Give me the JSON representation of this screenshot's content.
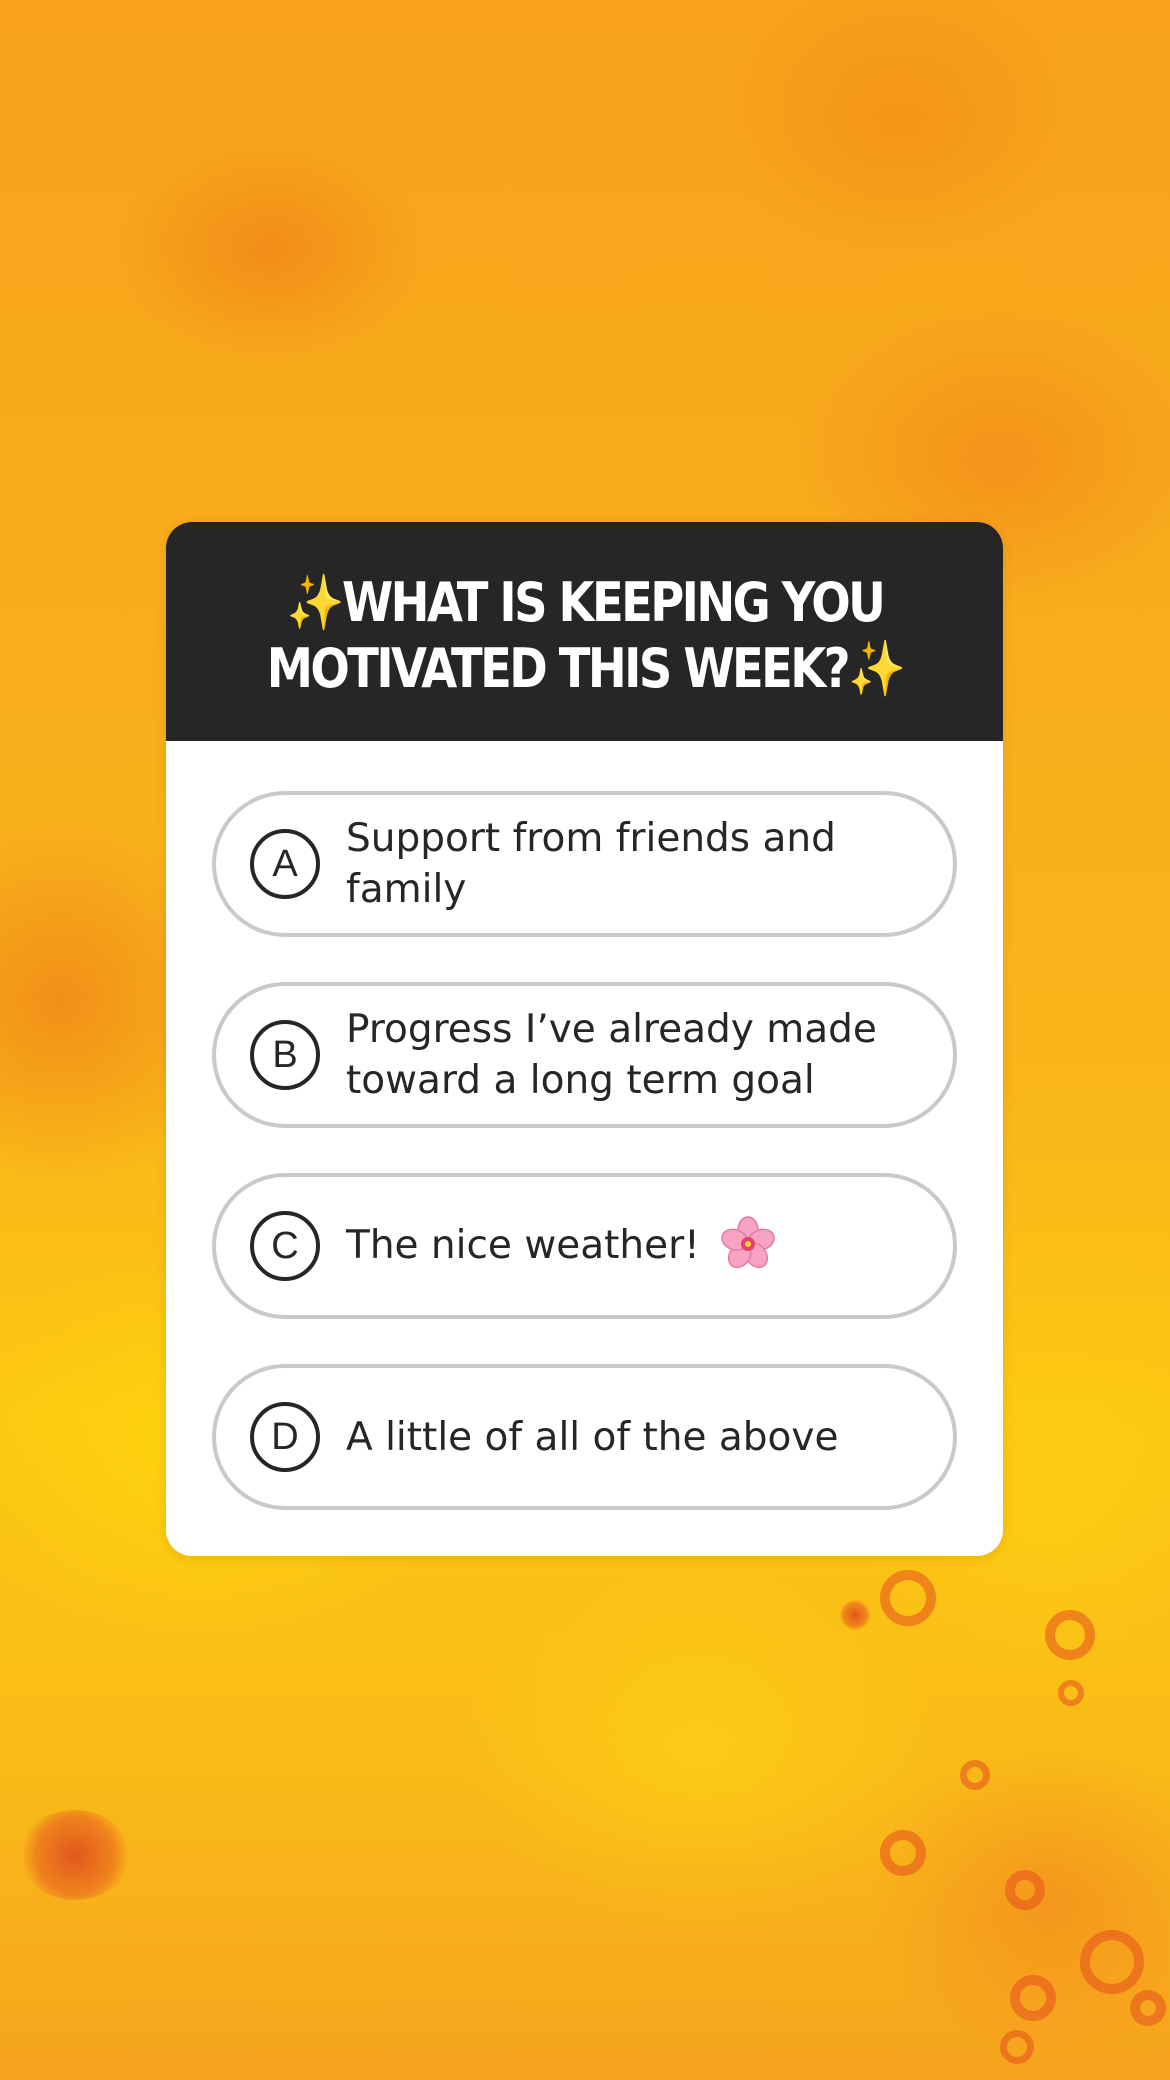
{
  "poll": {
    "title_prefix_emoji": "sparkles-icon",
    "title": "WHAT IS KEEPING YOU MOTIVATED THIS WEEK?",
    "title_line1": "✨WHAT IS KEEPING YOU",
    "title_line2": "MOTIVATED THIS WEEK?✨",
    "options": [
      {
        "letter": "A",
        "text": "Support from friends and family"
      },
      {
        "letter": "B",
        "text": "Progress I’ve already made toward a long term goal"
      },
      {
        "letter": "C",
        "text": "The nice weather!",
        "emoji": "cherry-blossom-icon"
      },
      {
        "letter": "D",
        "text": "A little of all of the above"
      }
    ]
  },
  "colors": {
    "header_bg": "#262626",
    "card_bg": "#ffffff",
    "option_border": "#c9c9c9",
    "background_orange": "#f7a21a",
    "background_yellow": "#fcc712"
  }
}
